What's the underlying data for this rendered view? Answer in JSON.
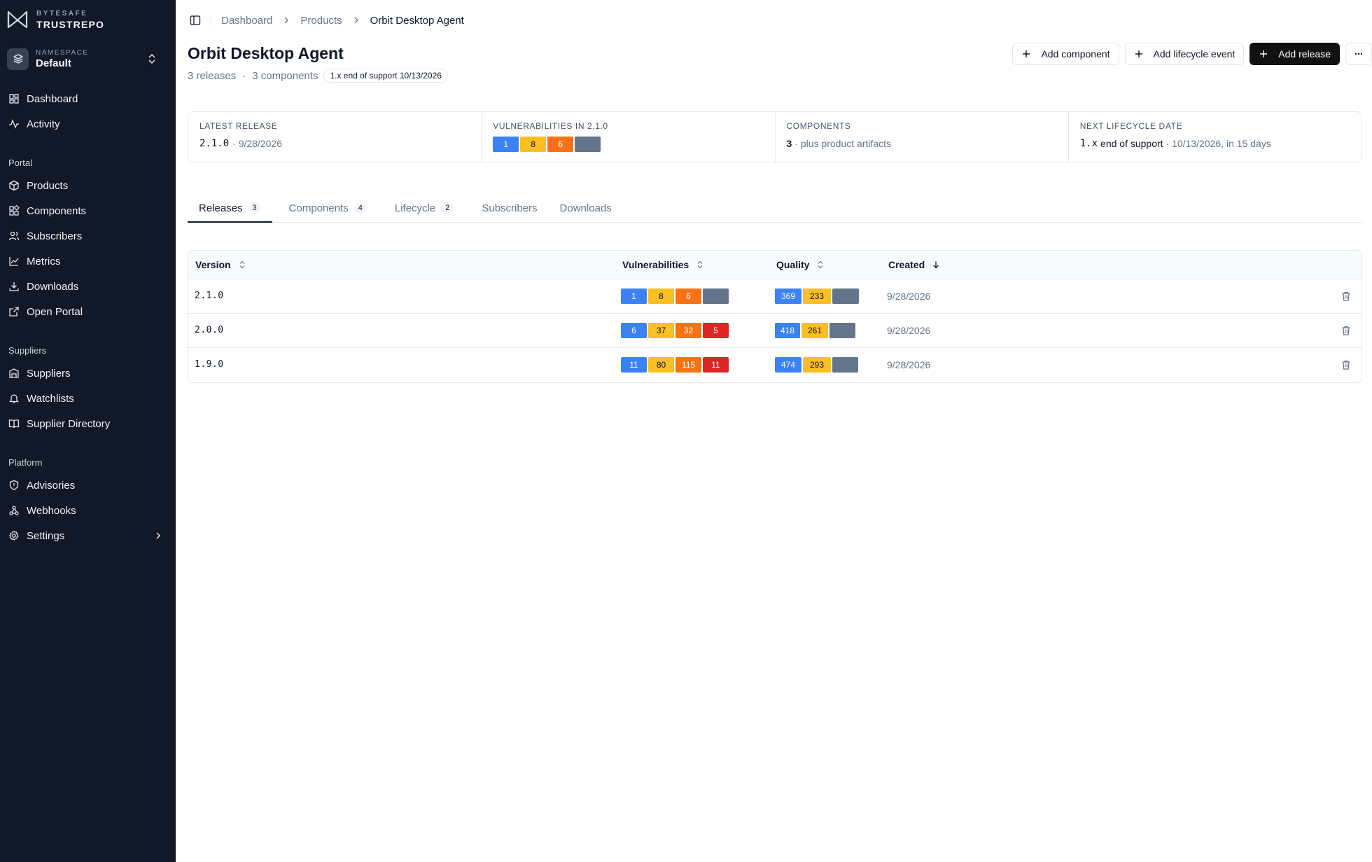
{
  "brand": {
    "top": "BYTESAFE",
    "name": "TRUSTREPO"
  },
  "namespace": {
    "label": "NAMESPACE",
    "value": "Default"
  },
  "nav": {
    "top": [
      {
        "label": "Dashboard",
        "icon": "dashboard-icon"
      },
      {
        "label": "Activity",
        "icon": "activity-icon"
      }
    ],
    "portal_title": "Portal",
    "portal": [
      {
        "label": "Products",
        "icon": "box-icon"
      },
      {
        "label": "Components",
        "icon": "grid-icon"
      },
      {
        "label": "Subscribers",
        "icon": "users-icon"
      },
      {
        "label": "Metrics",
        "icon": "chart-icon"
      },
      {
        "label": "Downloads",
        "icon": "download-icon"
      },
      {
        "label": "Open Portal",
        "icon": "external-link-icon"
      }
    ],
    "suppliers_title": "Suppliers",
    "suppliers": [
      {
        "label": "Suppliers",
        "icon": "building-icon"
      },
      {
        "label": "Watchlists",
        "icon": "bell-icon"
      },
      {
        "label": "Supplier Directory",
        "icon": "book-icon"
      }
    ],
    "platform_title": "Platform",
    "platform": [
      {
        "label": "Advisories",
        "icon": "shield-icon"
      },
      {
        "label": "Webhooks",
        "icon": "webhook-icon"
      },
      {
        "label": "Settings",
        "icon": "gear-icon"
      }
    ]
  },
  "breadcrumb": [
    "Dashboard",
    "Products",
    "Orbit Desktop Agent"
  ],
  "page": {
    "title": "Orbit Desktop Agent",
    "releases": "3 releases",
    "components": "3 components",
    "pill": "1.x end of support 10/13/2026"
  },
  "actions": {
    "add_component": "Add component",
    "add_lifecycle": "Add lifecycle event",
    "add_release": "Add release"
  },
  "stats": {
    "latest": {
      "label": "LATEST RELEASE",
      "version": "2.1.0",
      "date": "· 9/28/2026"
    },
    "vulns": {
      "label": "VULNERABILITIES IN 2.1.0",
      "values": [
        "1",
        "8",
        "6",
        ""
      ]
    },
    "components": {
      "label": "COMPONENTS",
      "count": "3",
      "note": "· plus product artifacts"
    },
    "lifecycle": {
      "label": "NEXT LIFECYCLE DATE",
      "version": "1.x",
      "event": "end of support",
      "note": "· 10/13/2026, in 15 days"
    }
  },
  "tabs": [
    {
      "label": "Releases",
      "count": "3"
    },
    {
      "label": "Components",
      "count": "4"
    },
    {
      "label": "Lifecycle",
      "count": "2"
    },
    {
      "label": "Subscribers",
      "count": ""
    },
    {
      "label": "Downloads",
      "count": ""
    }
  ],
  "table": {
    "headers": {
      "version": "Version",
      "vulns": "Vulnerabilities",
      "quality": "Quality",
      "created": "Created"
    },
    "rows": [
      {
        "version": "2.1.0",
        "vulns": [
          "1",
          "8",
          "6",
          ""
        ],
        "quality": [
          "369",
          "233",
          ""
        ],
        "created": "9/28/2026"
      },
      {
        "version": "2.0.0",
        "vulns": [
          "6",
          "37",
          "32",
          "5"
        ],
        "quality": [
          "418",
          "261",
          ""
        ],
        "created": "9/28/2026"
      },
      {
        "version": "1.9.0",
        "vulns": [
          "11",
          "80",
          "115",
          "11"
        ],
        "quality": [
          "474",
          "293",
          ""
        ],
        "created": "9/28/2026"
      }
    ]
  },
  "colors": {
    "sidebar": "#111827",
    "primary": "#111111",
    "blue": "#3b82f6",
    "yellow": "#fbbf24",
    "orange": "#f97316",
    "red": "#dc2626",
    "gray": "#64748b"
  }
}
